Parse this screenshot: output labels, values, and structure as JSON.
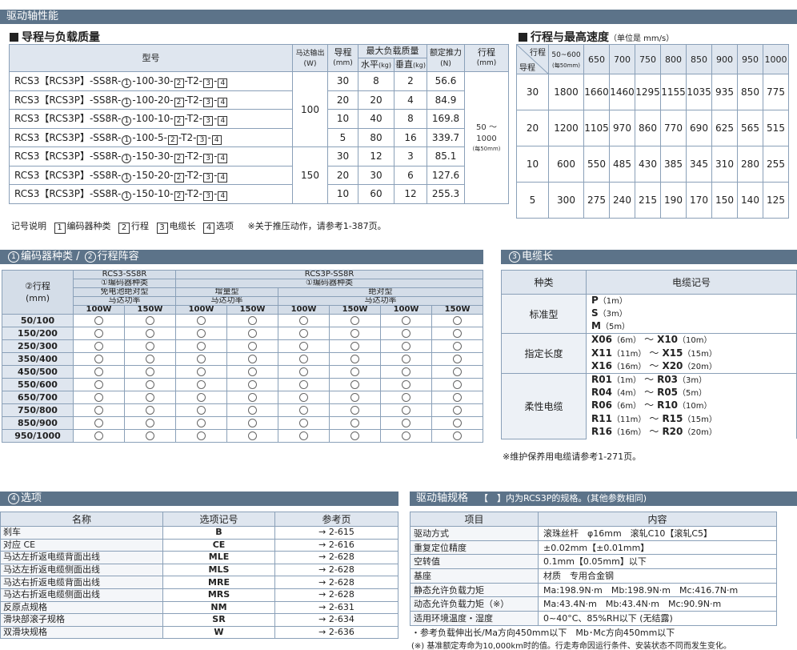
{
  "main_banner": "驱动轴性能",
  "left_heading": "导程与负载质量",
  "right_heading": "行程与最高速度",
  "right_heading_unit": "（单位是 mm/s）",
  "lead_table": {
    "headers": {
      "model": "型号",
      "motor": "马达输出",
      "motor_unit": "(W)",
      "lead": "导程",
      "lead_unit": "(mm)",
      "maxload": "最大负载质量",
      "horiz": "水平",
      "vert": "垂直",
      "kg": "(kg)",
      "thrust": "额定推力",
      "thrust_unit": "(N)",
      "stroke": "行程",
      "stroke_unit": "(mm)"
    },
    "rows": [
      {
        "pre": "RCS3【RCS3P】-SS8R-",
        "a": "1",
        "mid": "-100-30-",
        "b": "2",
        "c": "3",
        "d": "4",
        "lead": "30",
        "h": "8",
        "v": "2",
        "thrust": "56.6"
      },
      {
        "pre": "RCS3【RCS3P】-SS8R-",
        "a": "1",
        "mid": "-100-20-",
        "b": "2",
        "c": "3",
        "d": "4",
        "lead": "20",
        "h": "20",
        "v": "4",
        "thrust": "84.9"
      },
      {
        "pre": "RCS3【RCS3P】-SS8R-",
        "a": "1",
        "mid": "-100-10-",
        "b": "2",
        "c": "3",
        "d": "4",
        "lead": "10",
        "h": "40",
        "v": "8",
        "thrust": "169.8"
      },
      {
        "pre": "RCS3【RCS3P】-SS8R-",
        "a": "1",
        "mid": "-100-5-",
        "b": "2",
        "c": "3",
        "d": "4",
        "lead": "5",
        "h": "80",
        "v": "16",
        "thrust": "339.7"
      },
      {
        "pre": "RCS3【RCS3P】-SS8R-",
        "a": "1",
        "mid": "-150-30-",
        "b": "2",
        "c": "3",
        "d": "4",
        "lead": "30",
        "h": "12",
        "v": "3",
        "thrust": "85.1"
      },
      {
        "pre": "RCS3【RCS3P】-SS8R-",
        "a": "1",
        "mid": "-150-20-",
        "b": "2",
        "c": "3",
        "d": "4",
        "lead": "20",
        "h": "30",
        "v": "6",
        "thrust": "127.6"
      },
      {
        "pre": "RCS3【RCS3P】-SS8R-",
        "a": "1",
        "mid": "-150-10-",
        "b": "2",
        "c": "3",
        "d": "4",
        "lead": "10",
        "h": "60",
        "v": "12",
        "thrust": "255.3"
      }
    ],
    "motor_100": "100",
    "motor_150": "150",
    "stroke_range": "50 ～ 1000",
    "stroke_note": "(每50mm)"
  },
  "legend": {
    "label": "记号说明",
    "i1": "1",
    "t1": "编码器种类",
    "i2": "2",
    "t2": "行程",
    "i3": "3",
    "t3": "电缆长",
    "i4": "4",
    "t4": "选项",
    "note": "※关于推压动作，请参考1-387页。"
  },
  "speed_table": {
    "stroke_hdr": "行程",
    "lead_hdr": "导程",
    "first_col": "50~600",
    "first_col_note": "(每50mm)",
    "strokes": [
      "650",
      "700",
      "750",
      "800",
      "850",
      "900",
      "950",
      "1000"
    ],
    "rows": [
      {
        "lead": "30",
        "values": [
          "1800",
          "1660",
          "1460",
          "1295",
          "1155",
          "1035",
          "935",
          "850",
          "775"
        ]
      },
      {
        "lead": "20",
        "values": [
          "1200",
          "1105",
          "970",
          "860",
          "770",
          "690",
          "625",
          "565",
          "515"
        ]
      },
      {
        "lead": "10",
        "values": [
          "600",
          "550",
          "485",
          "430",
          "385",
          "345",
          "310",
          "280",
          "255"
        ]
      },
      {
        "lead": "5",
        "values": [
          "300",
          "275",
          "240",
          "215",
          "190",
          "170",
          "150",
          "140",
          "125"
        ]
      }
    ]
  },
  "enc_banner": {
    "c1": "1",
    "t1": "编码器种类 / ",
    "c2": "2",
    "t2": "行程阵容"
  },
  "enc_table": {
    "stroke_hdr": "②行程",
    "stroke_unit": "(mm)",
    "rcs3": "RCS3-SS8R",
    "rcs3p": "RCS3P-SS8R",
    "enc_kind": "①编码器种类",
    "abs_free": "免电池绝对型",
    "incr": "增量型",
    "abs": "绝对型",
    "motor_power": "马达功率",
    "w100": "100W",
    "w150": "150W",
    "strokes": [
      "50/100",
      "150/200",
      "250/300",
      "350/400",
      "450/500",
      "550/600",
      "650/700",
      "750/800",
      "850/900",
      "950/1000"
    ]
  },
  "cable_banner": {
    "c": "3",
    "t": "电缆长"
  },
  "cable_table": {
    "kind_hdr": "种类",
    "code_hdr": "电缆记号",
    "groups": [
      {
        "kind": "标准型",
        "items": [
          {
            "a": "P",
            "ua": "（1m）",
            "b": "",
            "ub": ""
          },
          {
            "a": "S",
            "ua": "（3m）",
            "b": "",
            "ub": ""
          },
          {
            "a": "M",
            "ua": "（5m）",
            "b": "",
            "ub": ""
          }
        ]
      },
      {
        "kind": "指定长度",
        "items": [
          {
            "a": "X06",
            "ua": "（6m）",
            "b": "X10",
            "ub": "（10m）"
          },
          {
            "a": "X11",
            "ua": "（11m）",
            "b": "X15",
            "ub": "（15m）"
          },
          {
            "a": "X16",
            "ua": "（16m）",
            "b": "X20",
            "ub": "（20m）"
          }
        ]
      },
      {
        "kind": "柔性电缆",
        "items": [
          {
            "a": "R01",
            "ua": "（1m）",
            "b": "R03",
            "ub": "（3m）"
          },
          {
            "a": "R04",
            "ua": "（4m）",
            "b": "R05",
            "ub": "（5m）"
          },
          {
            "a": "R06",
            "ua": "（6m）",
            "b": "R10",
            "ub": "（10m）"
          },
          {
            "a": "R11",
            "ua": "（11m）",
            "b": "R15",
            "ub": "（15m）"
          },
          {
            "a": "R16",
            "ua": "（16m）",
            "b": "R20",
            "ub": "（20m）"
          }
        ]
      }
    ],
    "tilde": "～",
    "note": "※维护保养用电缆请参考1-271页。"
  },
  "option_banner": {
    "c": "4",
    "t": "选项"
  },
  "option_table": {
    "h_name": "名称",
    "h_code": "选项记号",
    "h_page": "参考页",
    "rows": [
      {
        "name": "刹车",
        "code": "B",
        "page": "→ 2-615"
      },
      {
        "name": "对应 CE",
        "code": "CE",
        "page": "→ 2-616"
      },
      {
        "name": "马达左折返电缆背面出线",
        "code": "MLE",
        "page": "→ 2-628"
      },
      {
        "name": "马达左折返电缆侧面出线",
        "code": "MLS",
        "page": "→ 2-628"
      },
      {
        "name": "马达右折返电缆背面出线",
        "code": "MRE",
        "page": "→ 2-628"
      },
      {
        "name": "马达右折返电缆侧面出线",
        "code": "MRS",
        "page": "→ 2-628"
      },
      {
        "name": "反原点规格",
        "code": "NM",
        "page": "→ 2-631"
      },
      {
        "name": "滑块部滚子规格",
        "code": "SR",
        "page": "→ 2-634"
      },
      {
        "name": "双滑块规格",
        "code": "W",
        "page": "→ 2-636"
      }
    ]
  },
  "spec_banner": {
    "t": "驱动轴规格",
    "sub": "【　】内为RCS3P的规格。(其他参数相同)"
  },
  "spec_table": {
    "h_item": "项目",
    "h_content": "内容",
    "rows": [
      {
        "item": "驱动方式",
        "content": "滚珠丝杆　φ16mm　滚轧C10【滚轧C5】"
      },
      {
        "item": "重复定位精度",
        "content": "±0.02mm【±0.01mm】"
      },
      {
        "item": "空转值",
        "content": "0.1mm【0.05mm】以下"
      },
      {
        "item": "基座",
        "content": "材质　专用合金钢"
      },
      {
        "item": "静态允许负载力矩",
        "content": "Ma:198.9N·m　Mb:198.9N·m　Mc:416.7N·m"
      },
      {
        "item": "动态允许负载力矩（※）",
        "content": "Ma:43.4N·m　Mb:43.4N·m　Mc:90.9N·m"
      },
      {
        "item": "适用环境温度・湿度",
        "content": "0~40°C、85%RH以下 (无结露)"
      }
    ],
    "note1": "・参考负载伸出长/Ma方向450mm以下　Mb･Mc方向450mm以下",
    "note2": "(※) 基准额定寿命为10,000km时的值。行走寿命因运行条件、安装状态不同而发生变化。"
  }
}
